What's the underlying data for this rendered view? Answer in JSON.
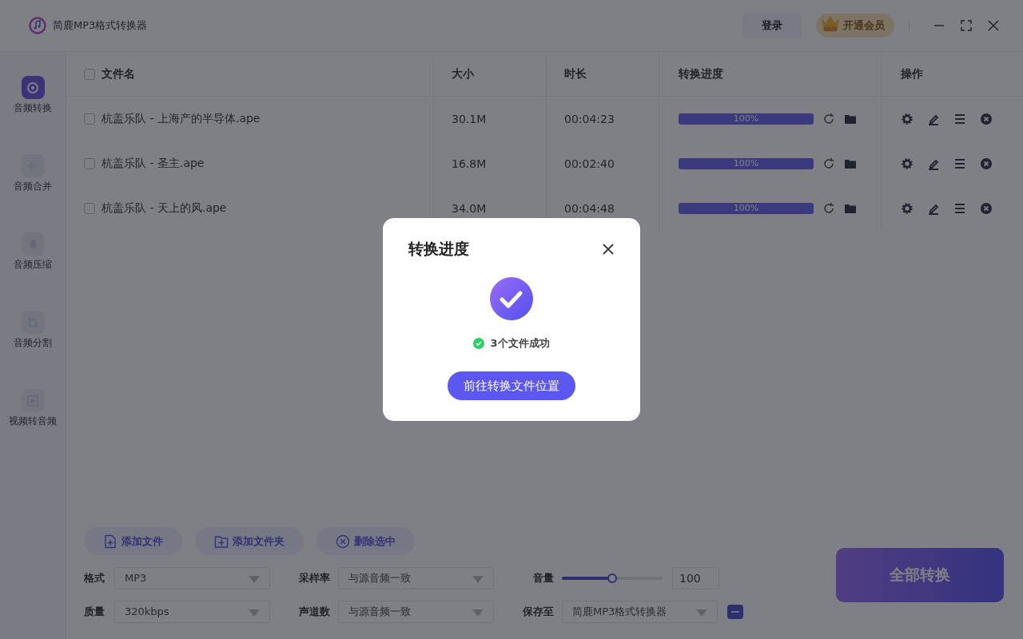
{
  "window": {
    "title": "简鹿MP3格式转换器",
    "login": "登录",
    "vip": "开通会员"
  },
  "sidebar": {
    "items": [
      {
        "label": "音频转换",
        "selected": true
      },
      {
        "label": "音频合并",
        "selected": false
      },
      {
        "label": "音频压缩",
        "selected": false
      },
      {
        "label": "音频分割",
        "selected": false
      },
      {
        "label": "视频转音频",
        "selected": false
      }
    ]
  },
  "table": {
    "columns": [
      "文件名",
      "大小",
      "时长",
      "转换进度",
      "操作"
    ],
    "all_checked": false,
    "rows": [
      {
        "checked": false,
        "name": "杭盖乐队 - 上海产的半导体.ape",
        "size": "30.1M",
        "duration": "00:04:23",
        "level": 1,
        "progress": "100%"
      },
      {
        "checked": false,
        "name": "杭盖乐队 - 圣主.ape",
        "size": "16.8M",
        "duration": "00:02:40",
        "level": 1,
        "progress": "100%"
      },
      {
        "checked": false,
        "name": "杭盖乐队 - 天上的风.ape",
        "size": "34.0M",
        "duration": "00:04:48",
        "level": 1,
        "progress": "100%"
      }
    ]
  },
  "toolbar": {
    "buttons": [
      "添加文件",
      "添加文件夹",
      "删除选中"
    ]
  },
  "settings": {
    "format": {
      "label": "格式",
      "value": "MP3"
    },
    "sample_rate": {
      "label": "采样率",
      "value": "与源音频一致"
    },
    "volume": {
      "label": "音量",
      "level": 0.5,
      "value": "100"
    },
    "quality": {
      "label": "质量",
      "value": "320kbps"
    },
    "channels": {
      "label": "声道数",
      "value": "与源音频一致"
    },
    "save_to": {
      "label": "保存至",
      "value": "简鹿MP3格式转换器"
    }
  },
  "convert_all": "全部转换",
  "dialog": {
    "title": "转换进度",
    "status": "3个文件成功",
    "button": "前往转换文件位置"
  }
}
